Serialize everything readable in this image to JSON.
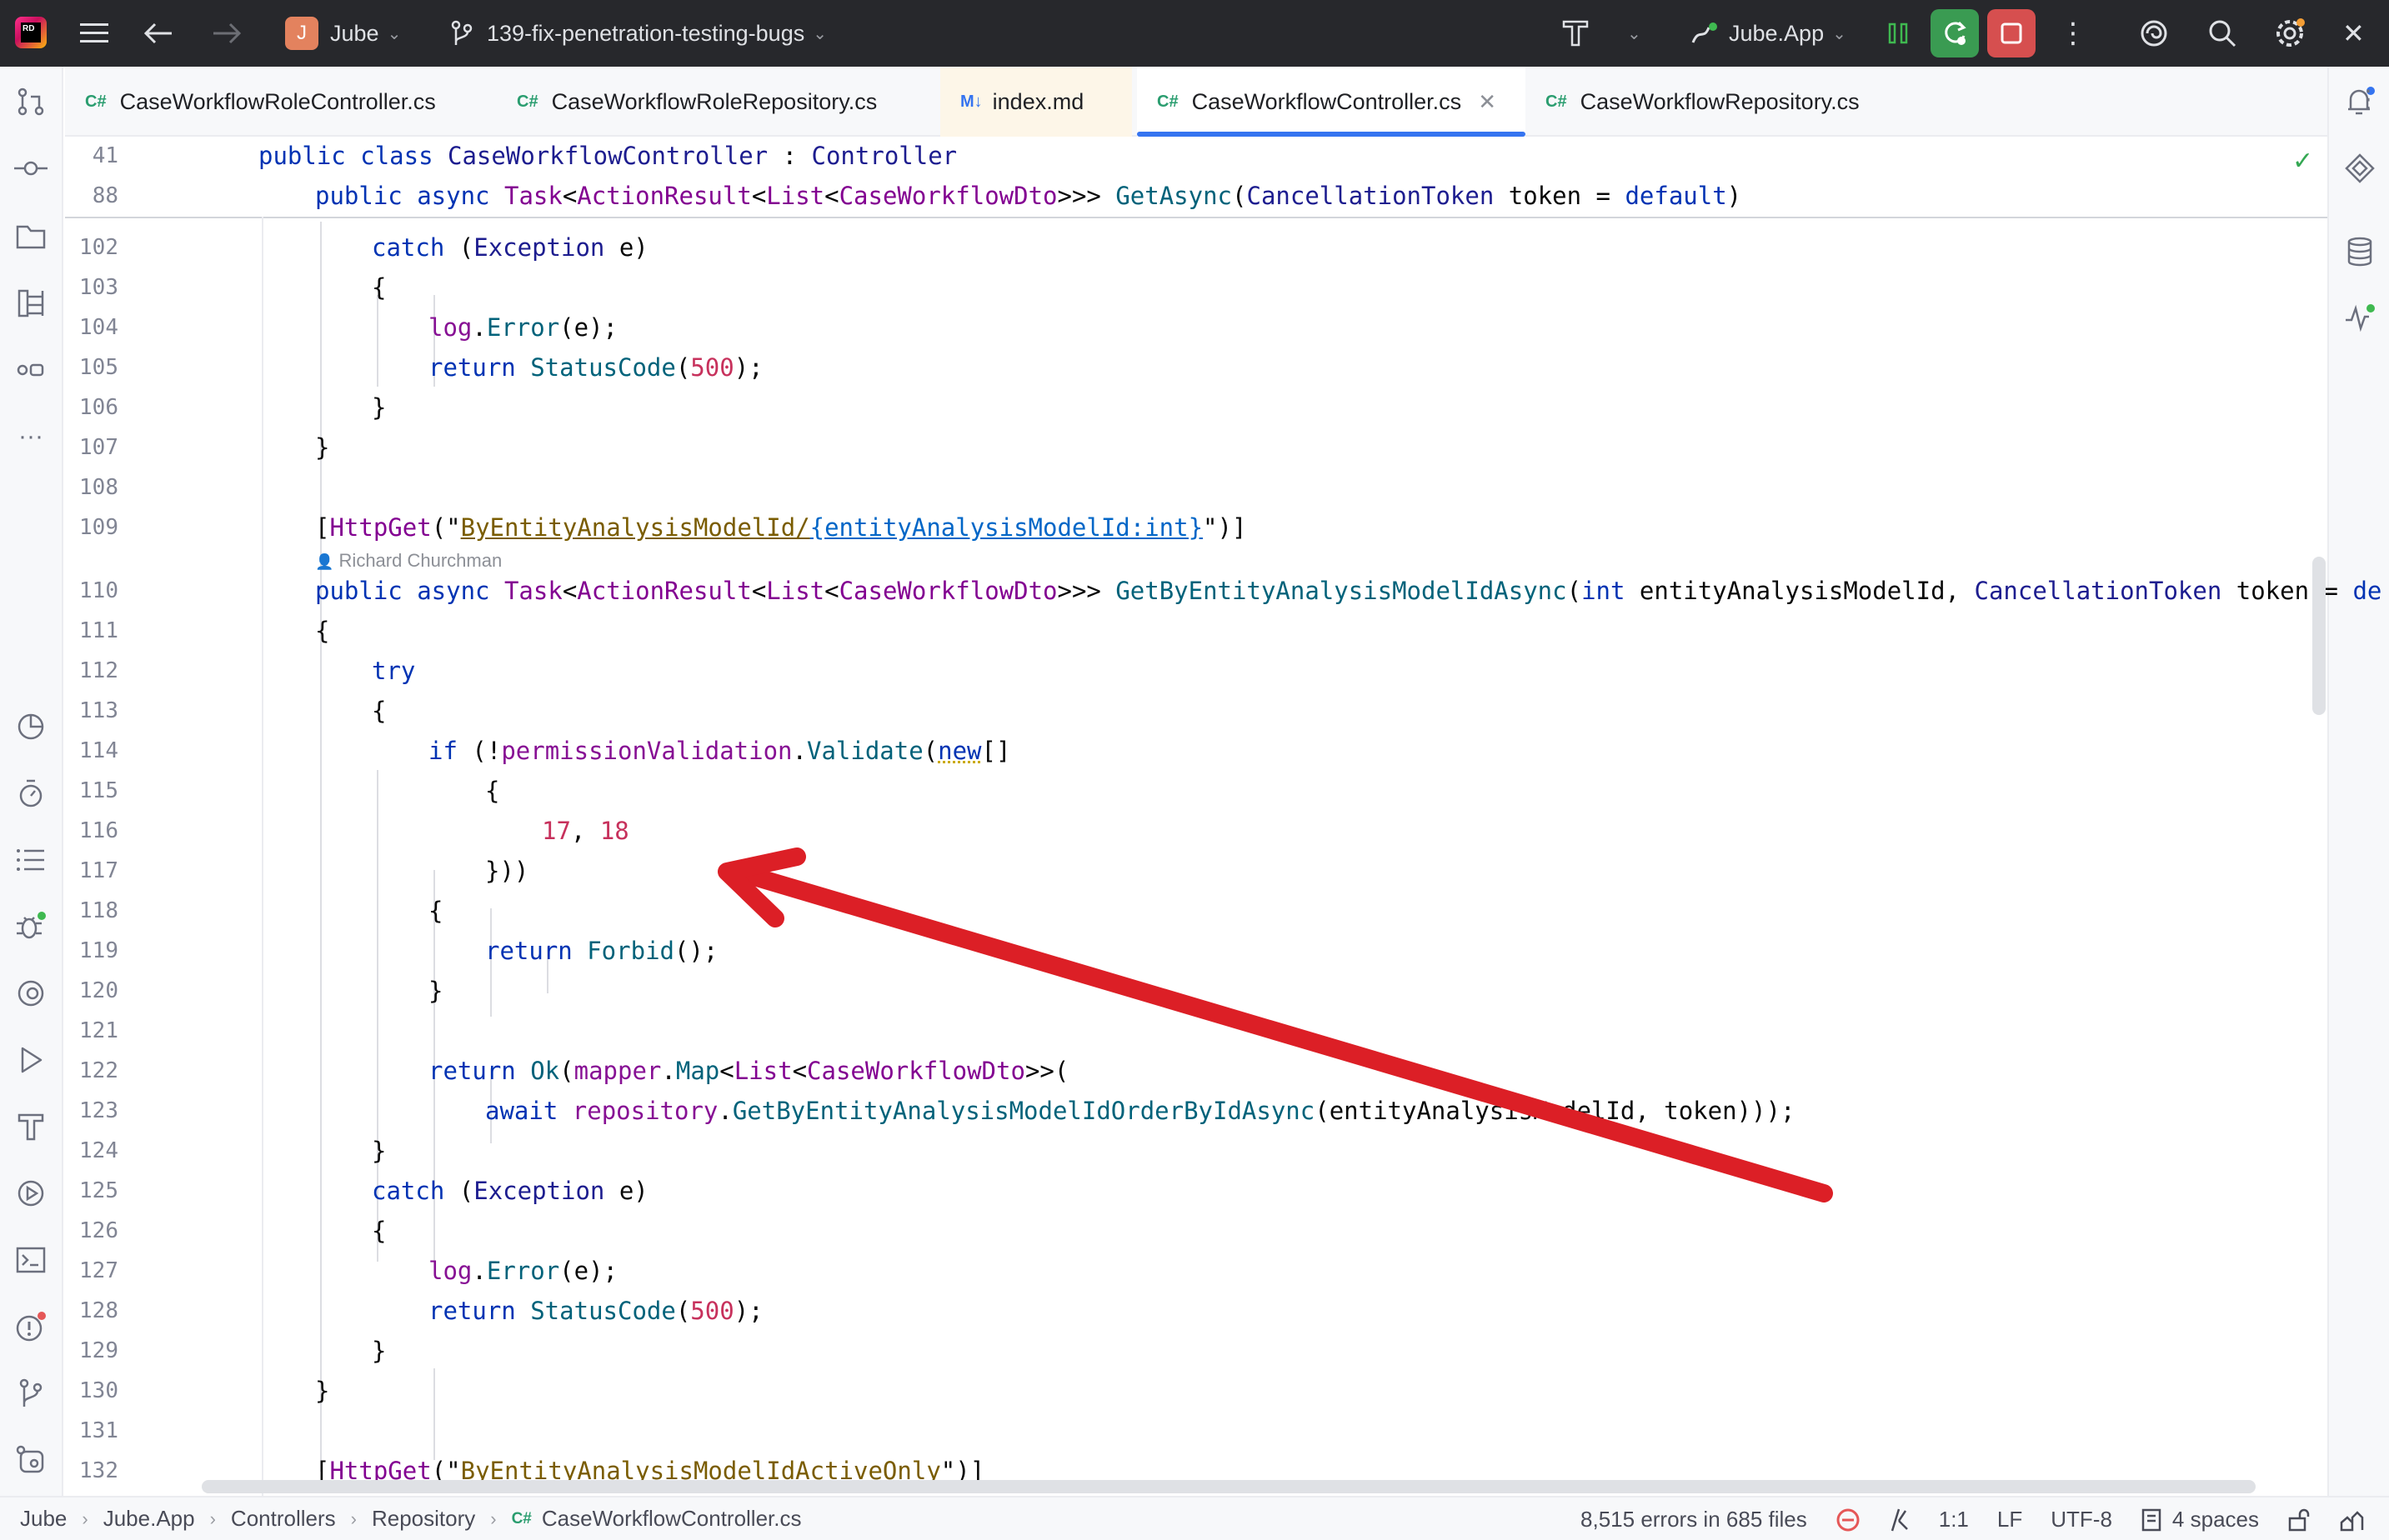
{
  "titlebar": {
    "project_initial": "J",
    "project_name": "Jube",
    "branch": "139-fix-penetration-testing-bugs",
    "run_config": "Jube.App"
  },
  "tabs": [
    {
      "icon": "C#",
      "label": "CaseWorkflowRoleController.cs"
    },
    {
      "icon": "C#",
      "label": "CaseWorkflowRoleRepository.cs"
    },
    {
      "icon": "M↓",
      "label": "index.md"
    },
    {
      "icon": "C#",
      "label": "CaseWorkflowController.cs",
      "active": true
    },
    {
      "icon": "C#",
      "label": "CaseWorkflowRepository.cs"
    }
  ],
  "editor": {
    "sticky_lines": [
      "41",
      "88"
    ],
    "line_numbers": [
      "102",
      "103",
      "104",
      "105",
      "106",
      "107",
      "108",
      "109",
      "110",
      "111",
      "112",
      "113",
      "114",
      "115",
      "116",
      "117",
      "118",
      "119",
      "120",
      "121",
      "122",
      "123",
      "124",
      "125",
      "126",
      "127",
      "128",
      "129",
      "130",
      "131",
      "132"
    ],
    "author": "Richard Churchman",
    "sticky_41": {
      "kw_public": "public",
      "kw_class": "class",
      "class_name": "CaseWorkflowController",
      "colon": " : ",
      "base": "Controller"
    },
    "sticky_88": {
      "kw": "public async",
      "ret_a": "Task",
      "ret_b": "<",
      "ret_c": "ActionResult",
      "ret_d": "<",
      "ret_e": "List",
      "ret_f": "<",
      "ret_g": "CaseWorkflowDto",
      "ret_h": ">>> ",
      "method": "GetAsync",
      "open": "(",
      "ptype": "CancellationToken",
      "pname": " token = ",
      "pdef": "default",
      "close": ")"
    },
    "l102": {
      "kw": "catch",
      "open": " (",
      "type": "Exception",
      "rest": " e)"
    },
    "l103": "{",
    "l104": {
      "obj": "log",
      "dot": ".",
      "method": "Error",
      "rest": "(e);"
    },
    "l105": {
      "kw": "return",
      "method": " StatusCode",
      "open": "(",
      "num": "500",
      "close": ");"
    },
    "l106": "}",
    "l107": "}",
    "l109": {
      "open": "[",
      "attr": "HttpGet",
      "p1": "(\"",
      "route": "ByEntityAnalysisModelId/",
      "inject": "{entityAnalysisModelId:int}",
      "p2": "\")]"
    },
    "l110": {
      "kw": "public async",
      "ret_a": " Task",
      "ret_b": "<",
      "ret_c": "ActionResult",
      "ret_d": "<",
      "ret_e": "List",
      "ret_f": "<",
      "ret_g": "CaseWorkflowDto",
      "ret_h": ">>> ",
      "method": "GetByEntityAnalysisModelIdAsync",
      "open": "(",
      "kw_int": "int",
      "p1": " entityAnalysisModelId, ",
      "ptype": "CancellationToken",
      "p2": " token = ",
      "pdef": "de"
    },
    "l111": "{",
    "l112": "try",
    "l113": "{",
    "l114": {
      "kw": "if",
      "rest1": " (!",
      "field": "permissionValidation",
      "dot": ".",
      "method": "Validate",
      "open": "(",
      "kw_new": "new",
      "rest2": "[]"
    },
    "l115": "{",
    "l116": {
      "n1": "17",
      "sep": ", ",
      "n2": "18"
    },
    "l117": "}))",
    "l118": "{",
    "l119": {
      "kw": "return",
      "method": " Forbid",
      "rest": "();"
    },
    "l120": "}",
    "l122": {
      "kw": "return",
      "m1": " Ok",
      "open": "(",
      "field": "mapper",
      "dot": ".",
      "m2": "Map",
      "lt": "<",
      "t1": "List",
      "lt2": "<",
      "t2": "CaseWorkflowDto",
      "rest": ">>("
    },
    "l123": {
      "kw": "await",
      "field": " repository",
      "dot": ".",
      "method": "GetByEntityAnalysisModelIdOrderByIdAsync",
      "rest": "(entityAnalysisModelId, token)));"
    },
    "l124": "}",
    "l125": {
      "kw": "catch",
      "open": " (",
      "type": "Exception",
      "rest": " e)"
    },
    "l126": "{",
    "l127": {
      "obj": "log",
      "dot": ".",
      "method": "Error",
      "rest": "(e);"
    },
    "l128": {
      "kw": "return",
      "method": " StatusCode",
      "open": "(",
      "num": "500",
      "close": ");"
    },
    "l129": "}",
    "l130": "}",
    "l132": {
      "open": "[",
      "attr": "HttpGet",
      "p1": "(\"",
      "route": "ByEntityAnalysisModelIdActiveOnly",
      "p2": "\")]"
    }
  },
  "statusbar": {
    "crumbs": [
      "Jube",
      "Jube.App",
      "Controllers",
      "Repository",
      "CaseWorkflowController.cs"
    ],
    "crumb_icon": "C#",
    "errors": "8,515 errors in 685 files",
    "position": "1:1",
    "line_sep": "LF",
    "encoding": "UTF-8",
    "indent": "4 spaces"
  },
  "colors": {
    "titlebar_bg": "#27282c",
    "accent": "#3574f0",
    "annotation_arrow": "#dc1f26",
    "run_green": "#3a9b52",
    "stop_red": "#d64f4f"
  }
}
